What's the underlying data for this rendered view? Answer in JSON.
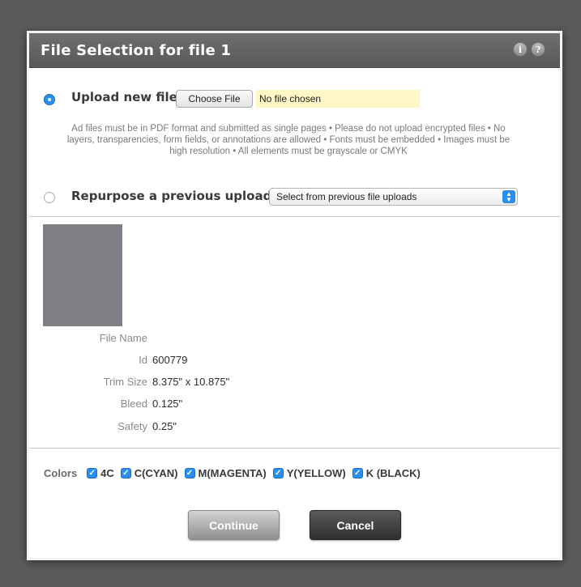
{
  "dialog": {
    "title": "File Selection for file 1",
    "info_icon": "info-icon",
    "help_icon": "help-icon"
  },
  "upload": {
    "label": "Upload new file",
    "choose_button": "Choose File",
    "file_status": "No file chosen",
    "selected": true
  },
  "notice": "Ad files must be in PDF format and submitted as single pages • Please do not upload encrypted files • No layers, transparencies, form fields, or annotations are allowed • Fonts must be embedded • Images must be high resolution • All elements must be grayscale or CMYK",
  "repurpose": {
    "label": "Repurpose a previous upload",
    "select_value": "Select from previous file uploads",
    "selected": false
  },
  "file_info": {
    "file_name_label": "File Name",
    "file_name_value": "",
    "id_label": "Id",
    "id_value": "600779",
    "trim_label": "Trim Size",
    "trim_value": "8.375\" x 10.875\"",
    "bleed_label": "Bleed",
    "bleed_value": "0.125\"",
    "safety_label": "Safety",
    "safety_value": "0.25\""
  },
  "colors": {
    "label": "Colors",
    "options": [
      {
        "label": "4C",
        "checked": true
      },
      {
        "label": "C(CYAN)",
        "checked": true
      },
      {
        "label": "M(MAGENTA)",
        "checked": true
      },
      {
        "label": "Y(YELLOW)",
        "checked": true
      },
      {
        "label": "K (BLACK)",
        "checked": true
      }
    ]
  },
  "actions": {
    "continue_label": "Continue",
    "cancel_label": "Cancel"
  },
  "theme": {
    "accent": "#2a8ef0",
    "titlebar": "#606060",
    "highlight": "#fdf7c6"
  }
}
